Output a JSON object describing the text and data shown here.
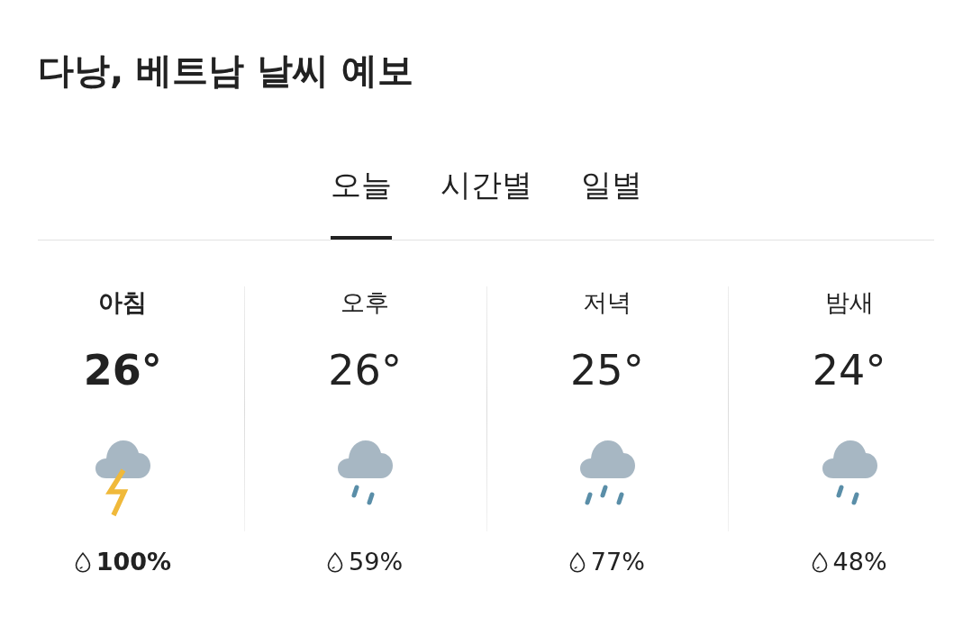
{
  "title": "다낭, 베트남 날씨 예보",
  "tabs": [
    {
      "label": "오늘",
      "selected": true
    },
    {
      "label": "시간별",
      "selected": false
    },
    {
      "label": "일별",
      "selected": false
    }
  ],
  "periods": [
    {
      "label": "아침",
      "temperature": "26°",
      "kind": "thunderstorm",
      "precipitation": "100%",
      "selected": true
    },
    {
      "label": "오후",
      "temperature": "26°",
      "kind": "light-rain",
      "precipitation": "59%",
      "selected": false
    },
    {
      "label": "저녁",
      "temperature": "25°",
      "kind": "rain",
      "precipitation": "77%",
      "selected": false
    },
    {
      "label": "밤새",
      "temperature": "24°",
      "kind": "light-rain",
      "precipitation": "48%",
      "selected": false
    }
  ]
}
